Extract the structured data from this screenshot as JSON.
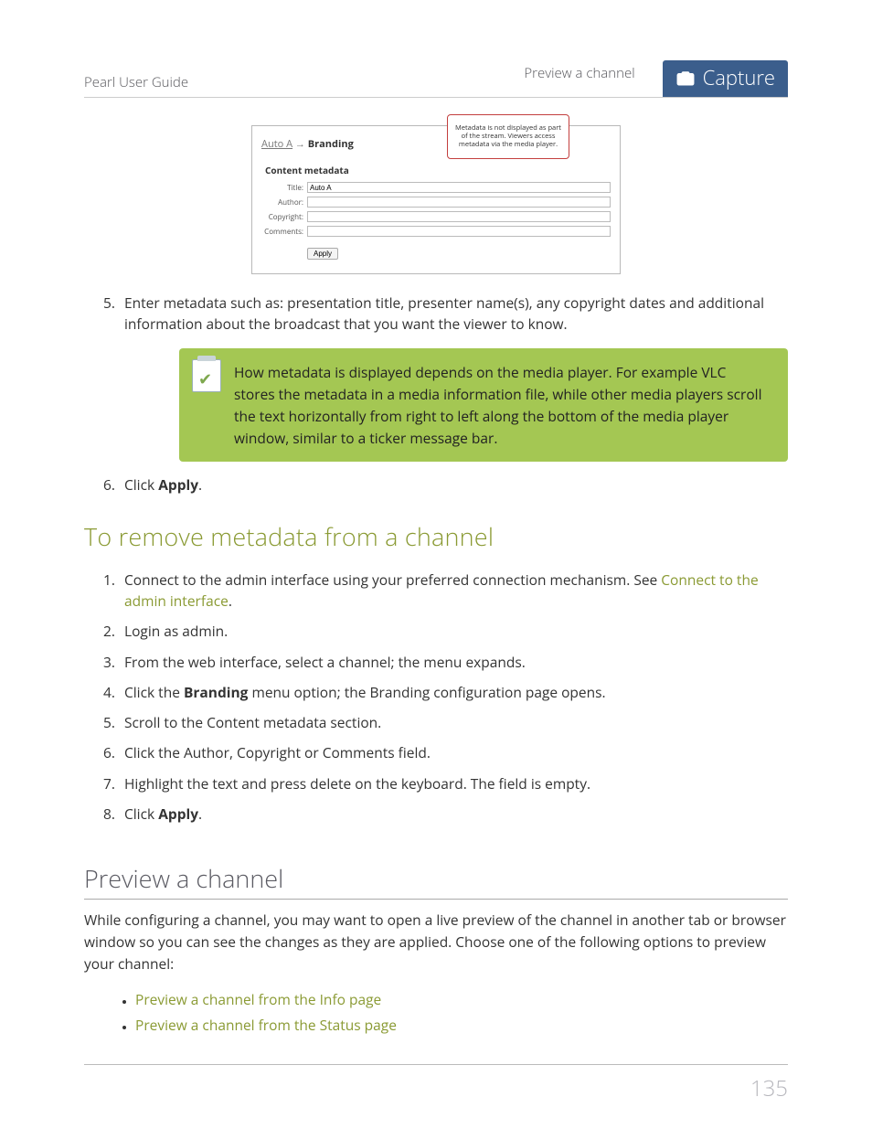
{
  "header": {
    "left": "Pearl User Guide",
    "right": "Preview a channel",
    "badge": "Capture"
  },
  "embed": {
    "crumb1": "Auto A",
    "arrow": "→",
    "crumb2": "Branding",
    "section": "Content metadata",
    "fields": {
      "title_label": "Title:",
      "title_value": "Auto A",
      "author_label": "Author:",
      "author_value": "",
      "copyright_label": "Copyright:",
      "copyright_value": "",
      "comments_label": "Comments:",
      "comments_value": ""
    },
    "apply": "Apply",
    "callout": "Metadata is not displayed as part of the stream. Viewers access metadata via the media player."
  },
  "step5": "Enter metadata such as: presentation title, presenter name(s), any copyright dates and additional information about the broadcast that you want the viewer to know.",
  "note": "How metadata is displayed depends on the media player. For example VLC stores the metadata in a media information file, while other media players scroll the text horizontally from right to left along the bottom of the media player window, similar to a ticker message bar.",
  "step6_pre": "Click ",
  "step6_bold": "Apply",
  "step6_post": ".",
  "h_remove": "To remove metadata from a channel",
  "remove_steps": {
    "s1_pre": "Connect to the admin interface using your preferred connection mechanism. See ",
    "s1_link": "Connect to the admin interface",
    "s1_post": ".",
    "s2": "Login as admin.",
    "s3": "From the web interface, select a channel; the menu expands.",
    "s4_pre": "Click the ",
    "s4_bold": "Branding",
    "s4_post": " menu option; the Branding configuration page opens.",
    "s5": "Scroll to the Content metadata section.",
    "s6": "Click the Author, Copyright or Comments field.",
    "s7": "Highlight the text and press delete on the keyboard. The field is empty.",
    "s8_pre": "Click ",
    "s8_bold": "Apply",
    "s8_post": "."
  },
  "h_preview": "Preview a channel",
  "preview_intro": "While configuring a channel, you may want to open a live preview of the channel in another tab or browser window so you can see the changes as they are applied. Choose one of the following options to preview your channel:",
  "preview_links": {
    "l1": "Preview a channel from the Info page",
    "l2": "Preview a channel from the Status page"
  },
  "page_number": "135"
}
